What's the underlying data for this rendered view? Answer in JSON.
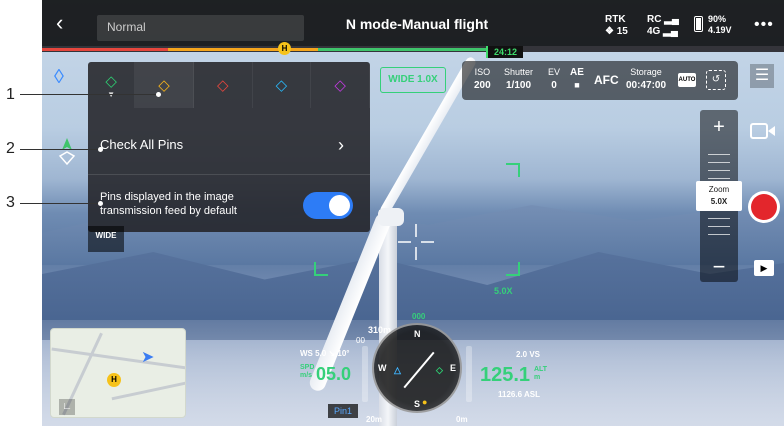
{
  "topbar": {
    "mode": "Normal",
    "title": "N mode-Manual flight",
    "rtk_label": "RTK",
    "rtk_sats": "15",
    "rc_label": "RC",
    "signal_label": "4G",
    "battery_pct": "90%",
    "battery_voltage": "4.19V"
  },
  "timeline": {
    "time": "24:12",
    "home_marker": "H"
  },
  "camera": {
    "lens_badge": "WIDE 1.0X",
    "iso_label": "ISO",
    "iso_value": "200",
    "shutter_label": "Shutter",
    "shutter_value": "1/100",
    "ev_label": "EV",
    "ev_value": "0",
    "ae_label": "AE",
    "focus_mode": "AFC",
    "storage_label": "Storage",
    "storage_value": "00:47:00",
    "auto_label": "AUTO"
  },
  "zoom": {
    "label": "Zoom",
    "value": "5.0X",
    "overlay": "5.0X"
  },
  "pin_panel": {
    "check_all_label": "Check All Pins",
    "toggle_label": "Pins displayed in the image transmission feed by default",
    "toggle_on": true,
    "colors": [
      "#2ecc71",
      "#f4b21b",
      "#e5463d",
      "#29b6f6",
      "#c03adf"
    ]
  },
  "wide_tab": "WIDE",
  "callouts": [
    "1",
    "2",
    "3"
  ],
  "map": {
    "home": "H"
  },
  "telemetry": {
    "heading": "000",
    "height_top": "310m",
    "dist_top": "00",
    "ws": "WS 5.0",
    "ws_deg": "10",
    "spd_label1": "SPD",
    "spd_label2": "m/s",
    "speed": "05.0",
    "alt_label1": "ALT",
    "alt_label2": "m",
    "altitude": "125.1",
    "vs": "2.0 VS",
    "asl": "1126.6 ASL",
    "pin_label": "Pin1",
    "dist_bottom_left": "20m",
    "dist_bottom_right": "0m"
  }
}
